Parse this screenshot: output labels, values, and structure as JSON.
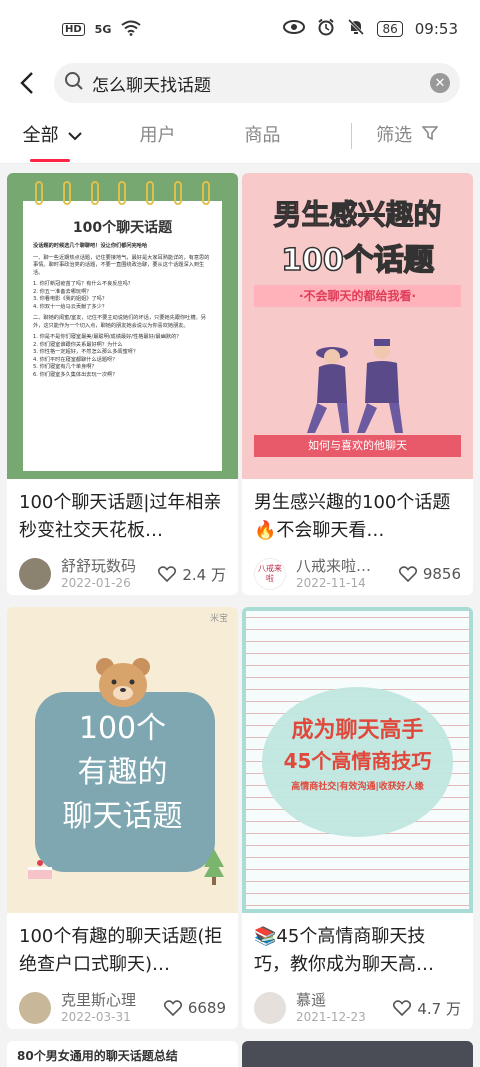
{
  "status": {
    "time": "09:53",
    "battery": "86",
    "hd": "HD",
    "signal": "5G"
  },
  "search": {
    "query": "怎么聊天找话题"
  },
  "tabs": [
    {
      "label": "全部"
    },
    {
      "label": "用户"
    },
    {
      "label": "商品"
    },
    {
      "label": "筛选"
    }
  ],
  "cards": [
    {
      "title": "100个聊天话题|过年相亲秒变社交天花板…",
      "author": "舒舒玩数码",
      "date": "2022-01-26",
      "likes": "2.4 万",
      "cover": {
        "heading": "100个聊天话题",
        "lines": [
          "没话题的时候选几个聊聊吧！没让你们都问完哈哈",
          "一、聊一些近期热点话题，记住要接地气，最好是大家耳熟能详的，有意思的事情。聊时事政治类的话题，不要一直围绕政治聊，要从这个话题深入到生活。",
          "1. 你打新冠疫苗了吗？有什么不良反应吗？",
          "2. 你五一准备去哪玩啊？",
          "3. 你看电影《我的姐姐》了吗？",
          "4. 你双十一给马云贡献了多少？",
          "二、聊她的闺蜜/室友，记住不要主动说她们的坏话，只要她先跟你吐槽。另外，这只能作为一个切入点，聊她的朋友她会说以为你喜欢她朋友。",
          "1. 你是不是你们寝室最美/最聪明/成绩最好/性格最好/最幽默的？",
          "2. 你们寝室谁跟你关系最好啊？为什么",
          "3. 你性格一定超好，不然怎么那么多闺蜜呀？",
          "4. 你们平时在寝室都聊什么话题呀？",
          "5. 你们寝室有几个单身啊？",
          "6. 你们寝室多久集体出去玩一次啊？"
        ]
      }
    },
    {
      "title": "男生感兴趣的100个话题🔥不会聊天看…",
      "author": "八戒来啦…",
      "date": "2022-11-14",
      "likes": "9856",
      "cover": {
        "heading1": "男生感兴趣的",
        "heading2": "100个话题",
        "subtitle": "·不会聊天的都给我看·",
        "caption": "如何与喜欢的他聊天"
      },
      "avatar_text": "八戒来啦"
    },
    {
      "title": "100个有趣的聊天话题(拒绝查户口式聊天)…",
      "author": "克里斯心理",
      "date": "2022-03-31",
      "likes": "6689",
      "cover": {
        "heading1": "100个",
        "heading2": "有趣的",
        "heading3": "聊天话题",
        "corner": "米宝"
      }
    },
    {
      "title": "📚45个高情商聊天技巧，教你成为聊天高…",
      "author": "慕遥",
      "date": "2021-12-23",
      "likes": "4.7 万",
      "cover": {
        "heading1": "成为聊天高手",
        "heading2": "45个高情商技巧",
        "subtitle": "高情商社交|有效沟通|收获好人缘"
      }
    }
  ],
  "bottom_card": {
    "title": "80个男女通用的聊天话题总结"
  }
}
